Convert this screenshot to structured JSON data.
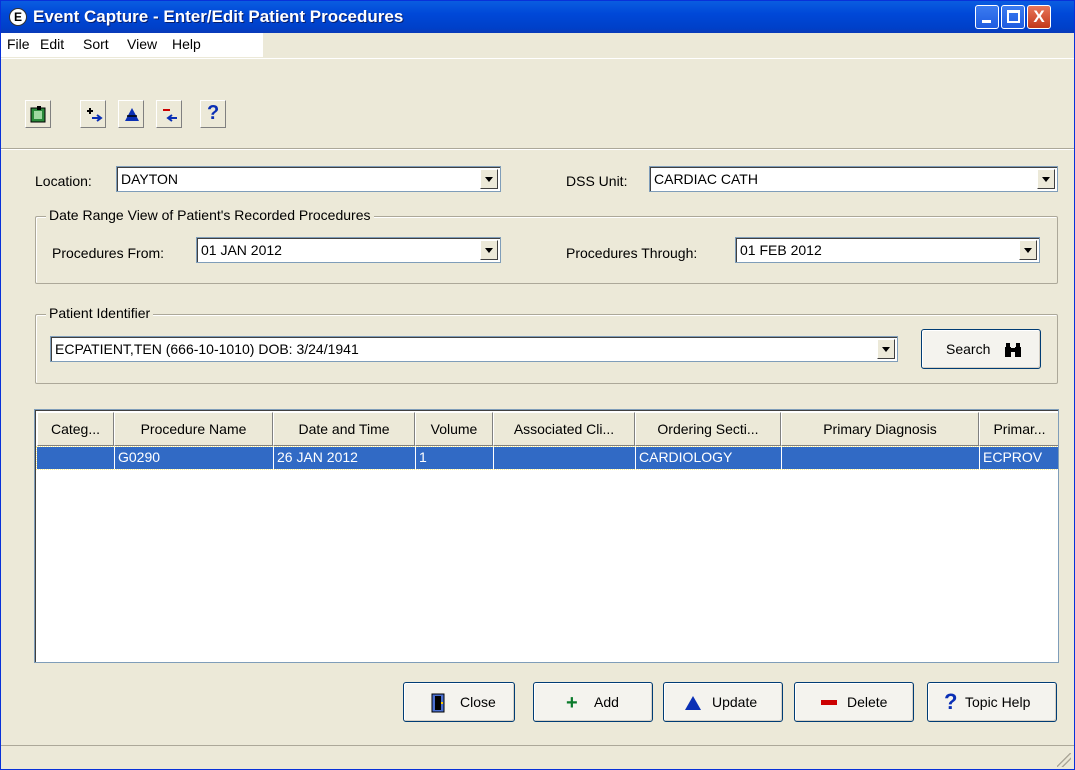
{
  "window": {
    "app_glyph": "E",
    "title": "Event Capture - Enter/Edit Patient Procedures",
    "close_glyph": "X"
  },
  "menu": [
    "File",
    "Edit",
    "Sort",
    "View",
    "Help"
  ],
  "toolbar": {
    "help_glyph": "?"
  },
  "location": {
    "label": "Location:",
    "value": "DAYTON"
  },
  "dss_unit": {
    "label": "DSS Unit:",
    "value": "CARDIAC CATH"
  },
  "date_range": {
    "title": "Date Range View of Patient's Recorded Procedures",
    "from_label": "Procedures From:",
    "from_value": "01 JAN 2012",
    "through_label": "Procedures Through:",
    "through_value": "01 FEB 2012"
  },
  "patient": {
    "title": "Patient Identifier",
    "value": "ECPATIENT,TEN  (666-10-1010)  DOB: 3/24/1941",
    "search_label": "Search"
  },
  "grid": {
    "columns": [
      "Categ...",
      "Procedure Name",
      "Date and Time",
      "Volume",
      "Associated Cli...",
      "Ordering Secti...",
      "Primary Diagnosis",
      "Primar..."
    ],
    "rows": [
      [
        "",
        "G0290",
        "26 JAN 2012",
        "1",
        "",
        "CARDIOLOGY",
        "",
        "ECPROV"
      ]
    ]
  },
  "buttons": {
    "close": "Close",
    "add": "Add",
    "update": "Update",
    "delete": "Delete",
    "topic_help": "Topic Help"
  }
}
